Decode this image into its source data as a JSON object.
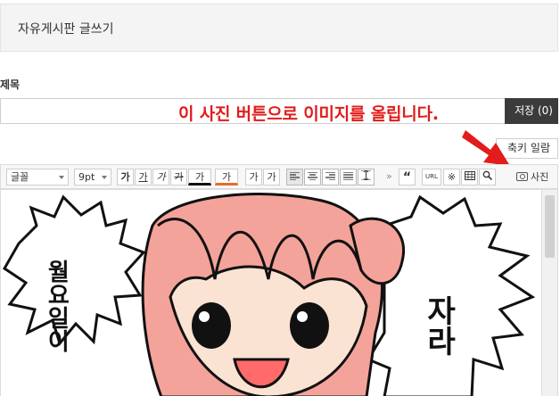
{
  "header": {
    "title": "자유게시판 글쓰기"
  },
  "subject": {
    "label": "제목",
    "value": ""
  },
  "save_button": {
    "label": "저장 (0)"
  },
  "annotation": {
    "text": "이 사진 버튼으로 이미지를 올립니다.",
    "color": "#e21b1b"
  },
  "shortcut_button": {
    "label": "축키 일람"
  },
  "toolbar": {
    "font_select": "글꼴",
    "size_select": "9pt",
    "format_buttons": [
      "가",
      "가",
      "가",
      "가",
      "가"
    ],
    "color_buttons": [
      "가",
      "가"
    ],
    "script_buttons": [
      "가",
      "가"
    ],
    "align_buttons": [
      "align-left-icon",
      "align-center-icon",
      "align-right-icon",
      "align-justify-icon",
      "line-height-icon"
    ],
    "more_chevron": "»",
    "quote_label": "“",
    "url_label": "URL",
    "special_char_label": "※",
    "table_icon": "table-icon",
    "search_icon": "search-icon",
    "photo_label": "사진"
  },
  "editor": {
    "comic_left_text": "월요일이",
    "comic_right_text": "자라",
    "accent": "#f4a39a"
  }
}
